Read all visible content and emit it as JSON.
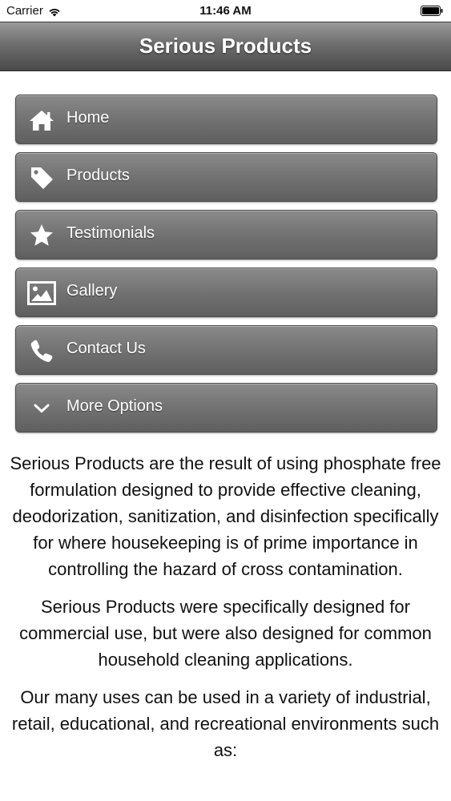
{
  "status_bar": {
    "carrier": "Carrier",
    "time": "11:46 AM"
  },
  "header": {
    "title": "Serious Products"
  },
  "menu": {
    "items": [
      {
        "label": "Home",
        "icon": "home-icon"
      },
      {
        "label": "Products",
        "icon": "tag-icon"
      },
      {
        "label": "Testimonials",
        "icon": "star-icon"
      },
      {
        "label": "Gallery",
        "icon": "image-icon"
      },
      {
        "label": "Contact Us",
        "icon": "phone-icon"
      },
      {
        "label": "More Options",
        "icon": "chevron-down-icon"
      }
    ]
  },
  "content": {
    "paragraphs": [
      "Serious Products are the result of using phosphate free formulation designed to provide effective cleaning, deodorization, sanitization, and disinfection specifically for where housekeeping is of prime importance in controlling the hazard of cross contamination.",
      "Serious Products were specifically designed for commercial use, but were also designed for common household cleaning applications.",
      "Our many uses can be used in a variety of industrial, retail, educational, and recreational environments such as:"
    ]
  },
  "colors": {
    "header_top": "#9a9a9a",
    "header_bottom": "#4a4a4a",
    "button_fill": "#727272",
    "button_text": "#ffffff",
    "body_text": "#111111"
  }
}
